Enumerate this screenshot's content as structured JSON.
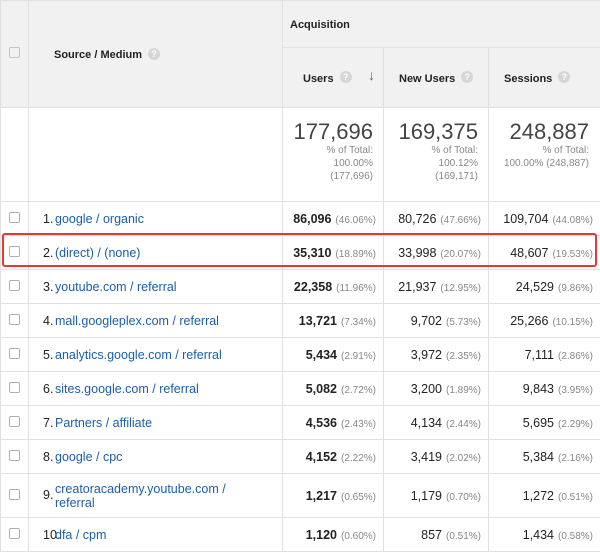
{
  "header": {
    "dimension_label": "Source / Medium",
    "group_label": "Acquisition",
    "columns": [
      {
        "label": "Users",
        "sorted": true
      },
      {
        "label": "New Users"
      },
      {
        "label": "Sessions"
      }
    ]
  },
  "totals": [
    {
      "value": "177,696",
      "line1": "% of Total:",
      "line2": "100.00%",
      "line3": "(177,696)"
    },
    {
      "value": "169,375",
      "line1": "% of Total:",
      "line2": "100.12%",
      "line3": "(169,171)"
    },
    {
      "value": "248,887",
      "line1": "% of Total:",
      "line2": "100.00% (248,887)",
      "line3": ""
    }
  ],
  "rows": [
    {
      "index": "1.",
      "source": "google / organic",
      "users": "86,096",
      "users_pct": "(46.06%)",
      "new_users": "80,726",
      "new_users_pct": "(47.66%)",
      "sessions": "109,704",
      "sessions_pct": "(44.08%)"
    },
    {
      "index": "2.",
      "source": "(direct) / (none)",
      "users": "35,310",
      "users_pct": "(18.89%)",
      "new_users": "33,998",
      "new_users_pct": "(20.07%)",
      "sessions": "48,607",
      "sessions_pct": "(19.53%)"
    },
    {
      "index": "3.",
      "source": "youtube.com / referral",
      "users": "22,358",
      "users_pct": "(11.96%)",
      "new_users": "21,937",
      "new_users_pct": "(12.95%)",
      "sessions": "24,529",
      "sessions_pct": "(9.86%)"
    },
    {
      "index": "4.",
      "source": "mall.googleplex.com / referral",
      "users": "13,721",
      "users_pct": "(7.34%)",
      "new_users": "9,702",
      "new_users_pct": "(5.73%)",
      "sessions": "25,266",
      "sessions_pct": "(10.15%)"
    },
    {
      "index": "5.",
      "source": "analytics.google.com / referral",
      "users": "5,434",
      "users_pct": "(2.91%)",
      "new_users": "3,972",
      "new_users_pct": "(2.35%)",
      "sessions": "7,111",
      "sessions_pct": "(2.86%)"
    },
    {
      "index": "6.",
      "source": "sites.google.com / referral",
      "users": "5,082",
      "users_pct": "(2.72%)",
      "new_users": "3,200",
      "new_users_pct": "(1.89%)",
      "sessions": "9,843",
      "sessions_pct": "(3.95%)"
    },
    {
      "index": "7.",
      "source": "Partners / affiliate",
      "users": "4,536",
      "users_pct": "(2.43%)",
      "new_users": "4,134",
      "new_users_pct": "(2.44%)",
      "sessions": "5,695",
      "sessions_pct": "(2.29%)"
    },
    {
      "index": "8.",
      "source": "google / cpc",
      "users": "4,152",
      "users_pct": "(2.22%)",
      "new_users": "3,419",
      "new_users_pct": "(2.02%)",
      "sessions": "5,384",
      "sessions_pct": "(2.16%)"
    },
    {
      "index": "9.",
      "source": "creatoracademy.youtube.com / referral",
      "users": "1,217",
      "users_pct": "(0.65%)",
      "new_users": "1,179",
      "new_users_pct": "(0.70%)",
      "sessions": "1,272",
      "sessions_pct": "(0.51%)"
    },
    {
      "index": "10.",
      "source": "dfa / cpm",
      "users": "1,120",
      "users_pct": "(0.60%)",
      "new_users": "857",
      "new_users_pct": "(0.51%)",
      "sessions": "1,434",
      "sessions_pct": "(0.58%)"
    }
  ],
  "highlighted_row_index": "2.",
  "colors": {
    "link": "#1a5fa8",
    "highlight": "#e53935",
    "header_bg": "#f1f1f1"
  },
  "icons": {
    "help": "question-mark-circle-icon",
    "sort": "arrow-down-icon",
    "checkbox": "checkbox-icon"
  }
}
